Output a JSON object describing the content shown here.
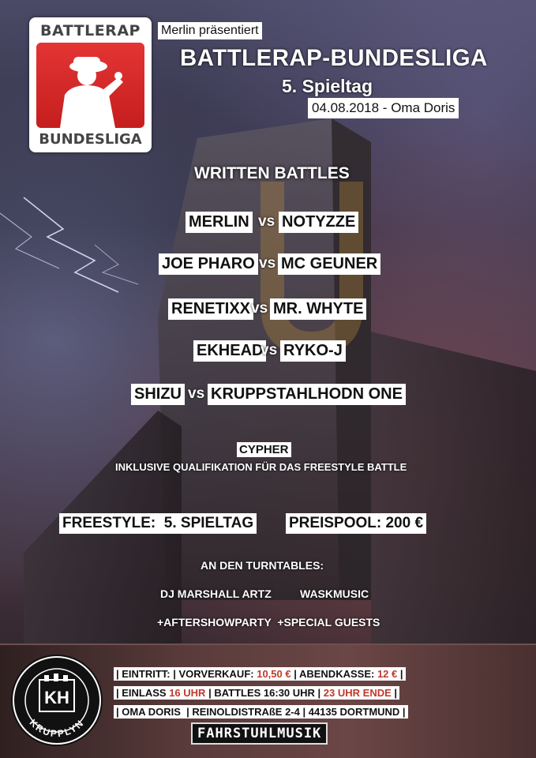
{
  "header": {
    "logo_top": "BATTLERAP",
    "logo_bottom": "BUNDESLIGA",
    "presenter": "Merlin präsentiert",
    "title": "BATTLERAP-BUNDESLIGA",
    "matchday": "5. Spieltag",
    "date_venue": "04.08.2018 - Oma Doris"
  },
  "written": {
    "heading": "WRITTEN BATTLES",
    "vs": "vs",
    "battles": [
      {
        "a": "MERLIN",
        "b": "NOTYZZE"
      },
      {
        "a": "JOE PHARO",
        "b": "MC GEUNER"
      },
      {
        "a": "RENETIXX",
        "b": "MR. WHYTE"
      },
      {
        "a": "EKHEAD",
        "b": "RYKO-J"
      },
      {
        "a": "SHIZU",
        "b": "KRUPPSTAHLHODN ONE"
      }
    ]
  },
  "cypher": {
    "label": "CYPHER",
    "sub": "INKLUSIVE QUALIFIKATION FÜR DAS FREESTYLE BATTLE"
  },
  "freestyle": {
    "left": "FREESTYLE:  5. SPIELTAG",
    "right": "PREISPOOL: 200 €"
  },
  "turntables": {
    "heading": "AN DEN TURNTABLES:",
    "dj1": "DJ MARSHALL ARTZ",
    "dj2": "WASKMUSIC",
    "extras": "+AFTERSHOWPARTY  +SPECIAL GUESTS"
  },
  "info": {
    "line1": {
      "p1": "| EINTRITT: | VORVERKAUF: ",
      "v1": "10,50 €",
      "p2": " | ABENDKASSE: ",
      "v2": "12 €",
      "p3": " |"
    },
    "line2": {
      "p1": "| EINLASS ",
      "v1": "16 UHR",
      "p2": " | BATTLES 16:30 UHR | ",
      "v2": "23 UHR ENDE",
      "p3": " |"
    },
    "line3": "| OMA DORIS  | REINOLDISTRAßE 2-4 | 44135 DORTMUND |",
    "footer_brand": "FAHRSTUHLMUSIK"
  },
  "badge": {
    "initials": "KH",
    "ring_text": "KRUPPLYN"
  },
  "colors": {
    "accent_red": "#c0392b",
    "logo_red": "#d42a2a",
    "label_bg": "#ffffff"
  }
}
